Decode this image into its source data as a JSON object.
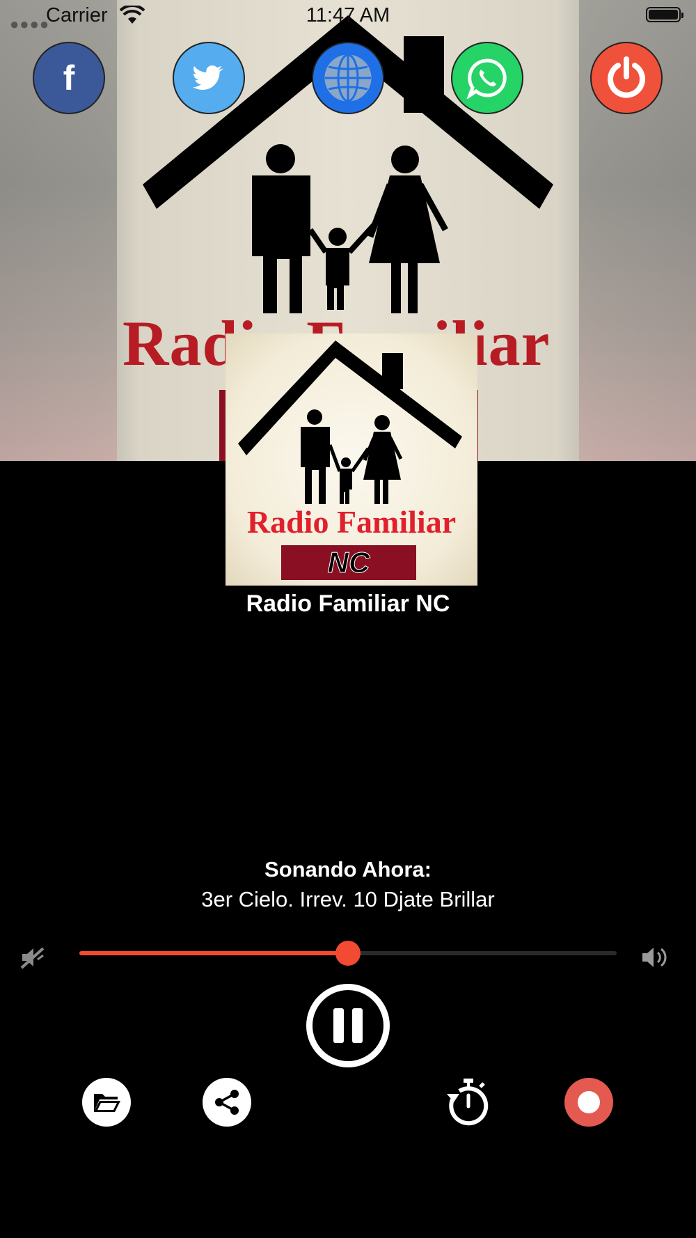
{
  "status_bar": {
    "carrier": "Carrier",
    "time": "11:47 AM"
  },
  "hero": {
    "brand_text": "Radio Familiar"
  },
  "social": [
    {
      "name": "facebook",
      "icon": "facebook-icon",
      "glyph": "f",
      "color": "#3b5998"
    },
    {
      "name": "twitter",
      "icon": "twitter-icon",
      "color": "#55acee"
    },
    {
      "name": "website",
      "icon": "globe-icon",
      "color": "#1f6fe6"
    },
    {
      "name": "whatsapp",
      "icon": "whatsapp-icon",
      "color": "#25d366"
    },
    {
      "name": "power",
      "icon": "power-icon",
      "color": "#f0513a"
    }
  ],
  "logo": {
    "brand_text": "Radio Familiar",
    "badge_text": "NC"
  },
  "station": {
    "name": "Radio Familiar NC"
  },
  "now_playing": {
    "label": "Sonando Ahora:",
    "track": "3er Cielo. Irrev. 10 Djate Brillar"
  },
  "volume": {
    "level_fraction": 0.5,
    "accent": "#f24b32"
  },
  "player": {
    "state": "playing",
    "control_icon": "pause-icon"
  },
  "actions": [
    {
      "name": "folder",
      "icon": "folder-icon"
    },
    {
      "name": "share",
      "icon": "share-icon"
    },
    {
      "name": "timer",
      "icon": "timer-icon"
    },
    {
      "name": "record",
      "icon": "record-icon",
      "color": "#e45a50"
    }
  ]
}
